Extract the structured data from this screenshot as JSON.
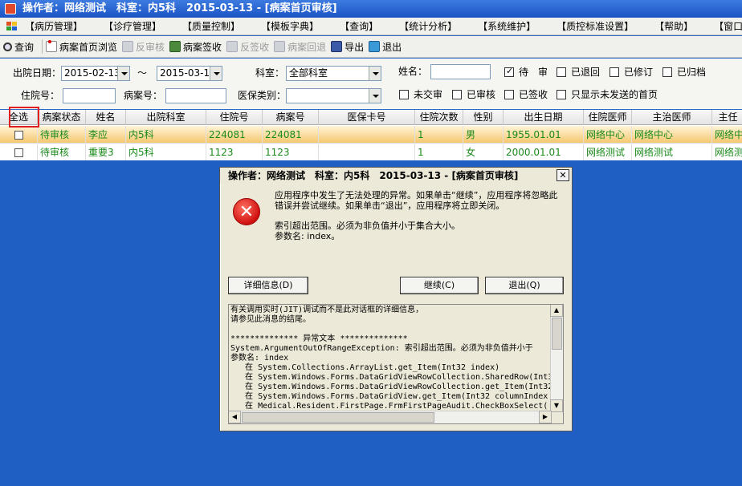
{
  "window": {
    "title": "操作者：网络测试　科室：内5科　2015-03-13 - [病案首页审核]"
  },
  "menu": [
    "【病历管理】",
    "【诊疗管理】",
    "【质量控制】",
    "【模板字典】",
    "【查询】",
    "【统计分析】",
    "【系统维护】",
    "【质控标准设置】",
    "【帮助】",
    "【窗口】"
  ],
  "toolbar": {
    "query": "查询",
    "browse": "病案首页浏览",
    "reverse_audit": "反审核",
    "sign_receive": "病案签收",
    "reverse_sign": "反签收",
    "case_return": "病案回退",
    "export": "导出",
    "exit": "退出"
  },
  "filter": {
    "discharge_date_label": "出院日期：",
    "date_from": "2015-02-13",
    "tilde": "～",
    "date_to": "2015-03-13",
    "dept_label": "科室：",
    "dept_value": "全部科室",
    "name_label": "姓名：",
    "name_value": "",
    "cb_pending": "待　审",
    "cb_returned": "已退回",
    "cb_revised": "已修订",
    "cb_archived": "已归档",
    "inpatient_no_label": "住院号：",
    "case_no_label": "病案号：",
    "insurance_label": "医保类别：",
    "insurance_value": "",
    "cb_not_submitted": "未交审",
    "cb_audited": "已审核",
    "cb_signed": "已签收",
    "cb_unsent_only": "只显示未发送的首页"
  },
  "grid": {
    "headers": [
      "全选",
      "病案状态",
      "姓名",
      "出院科室",
      "住院号",
      "病案号",
      "医保卡号",
      "住院次数",
      "性别",
      "出生日期",
      "住院医师",
      "主治医师",
      "主任"
    ],
    "rows": [
      [
        "",
        "待审核",
        "李应",
        "内5科",
        "224081",
        "224081",
        "",
        "1",
        "男",
        "1955.01.01",
        "网络中心",
        "网络中心",
        "网络中"
      ],
      [
        "",
        "待审核",
        "重要3",
        "内5科",
        "1123",
        "1123",
        "",
        "1",
        "女",
        "2000.01.01",
        "网络测试",
        "网络测试",
        "网络测"
      ]
    ]
  },
  "dialog": {
    "title": "操作者：网络测试　科室：内5科　2015-03-13 - [病案首页审核]",
    "close": "✕",
    "message1": "应用程序中发生了无法处理的异常。如果单击“继续”，应用程序将忽略此错误并尝试继续。如果单击“退出”，应用程序将立即关闭。",
    "message2": "索引超出范围。必须为非负值并小于集合大小。",
    "message3": "参数名: index。",
    "details_button": "详细信息(D)",
    "continue_button": "继续(C)",
    "quit_button": "退出(Q)",
    "details_text": "有关调用实时(JIT)调试而不是此对话框的详细信息，\n请参见此消息的结尾。\n\n************** 异常文本 **************\nSystem.ArgumentOutOfRangeException: 索引超出范围。必须为非负值并小于\n参数名: index\n   在 System.Collections.ArrayList.get_Item(Int32 index)\n   在 System.Windows.Forms.DataGridViewRowCollection.SharedRow(Int32\n   在 System.Windows.Forms.DataGridViewRowCollection.get_Item(Int32\n   在 System.Windows.Forms.DataGridView.get_Item(Int32 columnIndex\n   在 Medical.Resident.FirstPage.FrmFirstPageAudit.CheckBoxSelect("
  }
}
